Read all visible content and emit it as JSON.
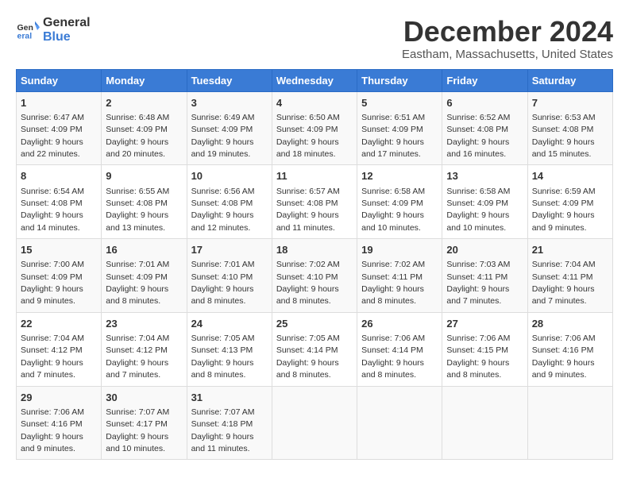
{
  "header": {
    "logo": {
      "general": "General",
      "blue": "Blue"
    },
    "title": "December 2024",
    "location": "Eastham, Massachusetts, United States"
  },
  "calendar": {
    "days_of_week": [
      "Sunday",
      "Monday",
      "Tuesday",
      "Wednesday",
      "Thursday",
      "Friday",
      "Saturday"
    ],
    "weeks": [
      [
        {
          "num": "1",
          "sunrise": "6:47 AM",
          "sunset": "4:09 PM",
          "daylight": "9 hours and 22 minutes."
        },
        {
          "num": "2",
          "sunrise": "6:48 AM",
          "sunset": "4:09 PM",
          "daylight": "9 hours and 20 minutes."
        },
        {
          "num": "3",
          "sunrise": "6:49 AM",
          "sunset": "4:09 PM",
          "daylight": "9 hours and 19 minutes."
        },
        {
          "num": "4",
          "sunrise": "6:50 AM",
          "sunset": "4:09 PM",
          "daylight": "9 hours and 18 minutes."
        },
        {
          "num": "5",
          "sunrise": "6:51 AM",
          "sunset": "4:09 PM",
          "daylight": "9 hours and 17 minutes."
        },
        {
          "num": "6",
          "sunrise": "6:52 AM",
          "sunset": "4:08 PM",
          "daylight": "9 hours and 16 minutes."
        },
        {
          "num": "7",
          "sunrise": "6:53 AM",
          "sunset": "4:08 PM",
          "daylight": "9 hours and 15 minutes."
        }
      ],
      [
        {
          "num": "8",
          "sunrise": "6:54 AM",
          "sunset": "4:08 PM",
          "daylight": "9 hours and 14 minutes."
        },
        {
          "num": "9",
          "sunrise": "6:55 AM",
          "sunset": "4:08 PM",
          "daylight": "9 hours and 13 minutes."
        },
        {
          "num": "10",
          "sunrise": "6:56 AM",
          "sunset": "4:08 PM",
          "daylight": "9 hours and 12 minutes."
        },
        {
          "num": "11",
          "sunrise": "6:57 AM",
          "sunset": "4:08 PM",
          "daylight": "9 hours and 11 minutes."
        },
        {
          "num": "12",
          "sunrise": "6:58 AM",
          "sunset": "4:09 PM",
          "daylight": "9 hours and 10 minutes."
        },
        {
          "num": "13",
          "sunrise": "6:58 AM",
          "sunset": "4:09 PM",
          "daylight": "9 hours and 10 minutes."
        },
        {
          "num": "14",
          "sunrise": "6:59 AM",
          "sunset": "4:09 PM",
          "daylight": "9 hours and 9 minutes."
        }
      ],
      [
        {
          "num": "15",
          "sunrise": "7:00 AM",
          "sunset": "4:09 PM",
          "daylight": "9 hours and 9 minutes."
        },
        {
          "num": "16",
          "sunrise": "7:01 AM",
          "sunset": "4:09 PM",
          "daylight": "9 hours and 8 minutes."
        },
        {
          "num": "17",
          "sunrise": "7:01 AM",
          "sunset": "4:10 PM",
          "daylight": "9 hours and 8 minutes."
        },
        {
          "num": "18",
          "sunrise": "7:02 AM",
          "sunset": "4:10 PM",
          "daylight": "9 hours and 8 minutes."
        },
        {
          "num": "19",
          "sunrise": "7:02 AM",
          "sunset": "4:11 PM",
          "daylight": "9 hours and 8 minutes."
        },
        {
          "num": "20",
          "sunrise": "7:03 AM",
          "sunset": "4:11 PM",
          "daylight": "9 hours and 7 minutes."
        },
        {
          "num": "21",
          "sunrise": "7:04 AM",
          "sunset": "4:11 PM",
          "daylight": "9 hours and 7 minutes."
        }
      ],
      [
        {
          "num": "22",
          "sunrise": "7:04 AM",
          "sunset": "4:12 PM",
          "daylight": "9 hours and 7 minutes."
        },
        {
          "num": "23",
          "sunrise": "7:04 AM",
          "sunset": "4:12 PM",
          "daylight": "9 hours and 7 minutes."
        },
        {
          "num": "24",
          "sunrise": "7:05 AM",
          "sunset": "4:13 PM",
          "daylight": "9 hours and 8 minutes."
        },
        {
          "num": "25",
          "sunrise": "7:05 AM",
          "sunset": "4:14 PM",
          "daylight": "9 hours and 8 minutes."
        },
        {
          "num": "26",
          "sunrise": "7:06 AM",
          "sunset": "4:14 PM",
          "daylight": "9 hours and 8 minutes."
        },
        {
          "num": "27",
          "sunrise": "7:06 AM",
          "sunset": "4:15 PM",
          "daylight": "9 hours and 8 minutes."
        },
        {
          "num": "28",
          "sunrise": "7:06 AM",
          "sunset": "4:16 PM",
          "daylight": "9 hours and 9 minutes."
        }
      ],
      [
        {
          "num": "29",
          "sunrise": "7:06 AM",
          "sunset": "4:16 PM",
          "daylight": "9 hours and 9 minutes."
        },
        {
          "num": "30",
          "sunrise": "7:07 AM",
          "sunset": "4:17 PM",
          "daylight": "9 hours and 10 minutes."
        },
        {
          "num": "31",
          "sunrise": "7:07 AM",
          "sunset": "4:18 PM",
          "daylight": "9 hours and 11 minutes."
        },
        null,
        null,
        null,
        null
      ]
    ]
  }
}
